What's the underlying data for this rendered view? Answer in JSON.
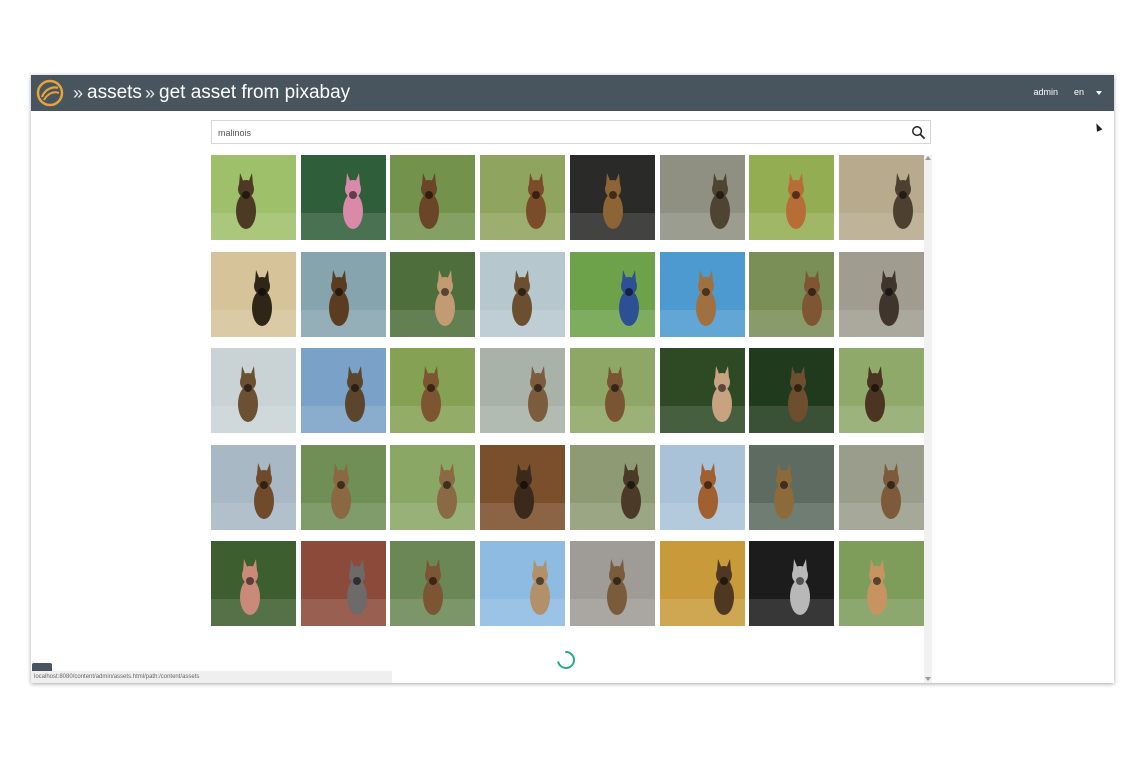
{
  "header": {
    "breadcrumb": [
      "assets",
      "get asset from pixabay"
    ],
    "separator": "»",
    "user": "admin",
    "language": "en",
    "background_color": "#48545e",
    "logo_color": "#e8a33a"
  },
  "search": {
    "value": "malinois",
    "icon": "search-icon"
  },
  "results": {
    "tiles": [
      {
        "bg": "#9fc06a",
        "fg": "#4d3a24"
      },
      {
        "bg": "#2f5f3a",
        "fg": "#d88aa8"
      },
      {
        "bg": "#73934d",
        "fg": "#6a4526"
      },
      {
        "bg": "#8fa45e",
        "fg": "#7b4c2a"
      },
      {
        "bg": "#2a2a28",
        "fg": "#8d6436"
      },
      {
        "bg": "#8f9082",
        "fg": "#4f4331"
      },
      {
        "bg": "#93ad52",
        "fg": "#b76d35"
      },
      {
        "bg": "#b7aa8d",
        "fg": "#4d4031"
      },
      {
        "bg": "#d6c39a",
        "fg": "#2f2618"
      },
      {
        "bg": "#86a4ad",
        "fg": "#5a3d20"
      },
      {
        "bg": "#4e6f3b",
        "fg": "#c29b72"
      },
      {
        "bg": "#b6c8ce",
        "fg": "#6c4f2e"
      },
      {
        "bg": "#6ea24a",
        "fg": "#2d4f94"
      },
      {
        "bg": "#4d9ad0",
        "fg": "#a07040"
      },
      {
        "bg": "#7a8e57",
        "fg": "#7f5634"
      },
      {
        "bg": "#a09c90",
        "fg": "#3f352d"
      },
      {
        "bg": "#c9d3d6",
        "fg": "#6b5032"
      },
      {
        "bg": "#7aa1c7",
        "fg": "#5b452d"
      },
      {
        "bg": "#84a154",
        "fg": "#7c5630"
      },
      {
        "bg": "#a8b2a8",
        "fg": "#7b5c3d"
      },
      {
        "bg": "#8fa766",
        "fg": "#7a5533"
      },
      {
        "bg": "#2d4a25",
        "fg": "#c7a382"
      },
      {
        "bg": "#1f3a1c",
        "fg": "#6d4e2e"
      },
      {
        "bg": "#8fa96b",
        "fg": "#4b3421"
      },
      {
        "bg": "#a8b8c5",
        "fg": "#6f4b2b"
      },
      {
        "bg": "#6f8f56",
        "fg": "#8a6842"
      },
      {
        "bg": "#8aa766",
        "fg": "#8a6a45"
      },
      {
        "bg": "#7a4f2c",
        "fg": "#3b2a1b"
      },
      {
        "bg": "#8d9a73",
        "fg": "#4a3a27"
      },
      {
        "bg": "#a9c2d8",
        "fg": "#a06030"
      },
      {
        "bg": "#5d6b60",
        "fg": "#8c6a3c"
      },
      {
        "bg": "#9a9d8c",
        "fg": "#7c5a3a"
      },
      {
        "bg": "#3d5e2e",
        "fg": "#c98a7a"
      },
      {
        "bg": "#8b4a3a",
        "fg": "#6d6a69"
      },
      {
        "bg": "#6a8755",
        "fg": "#7c5634"
      },
      {
        "bg": "#8dbbe2",
        "fg": "#b2916a"
      },
      {
        "bg": "#9f9b97",
        "fg": "#7a5b3b"
      },
      {
        "bg": "#c99a3a",
        "fg": "#4e3822"
      },
      {
        "bg": "#1c1c1c",
        "fg": "#b8b8b8"
      },
      {
        "bg": "#7e9d5a",
        "fg": "#c79461"
      }
    ]
  },
  "status": {
    "url": "localhost:8080/content/admin/assets.html/path:/content/assets"
  },
  "loading": {
    "spinner_color": "#2aa88a"
  }
}
